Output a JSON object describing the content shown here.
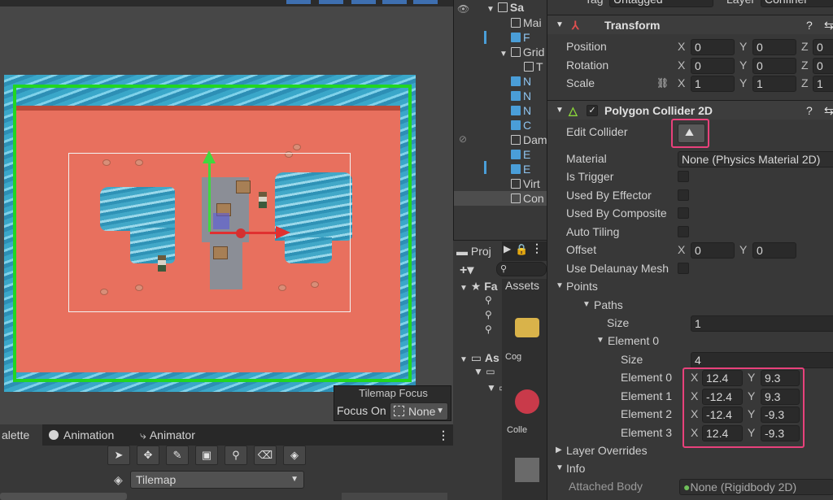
{
  "hierarchy": {
    "items": [
      {
        "label": "Sa",
        "indent": 0
      },
      {
        "label": "Mai",
        "indent": 1
      },
      {
        "label": "F",
        "indent": 1
      },
      {
        "label": "Grid",
        "indent": 1
      },
      {
        "label": "T",
        "indent": 2
      },
      {
        "label": "N",
        "indent": 1
      },
      {
        "label": "N",
        "indent": 1
      },
      {
        "label": "N",
        "indent": 1
      },
      {
        "label": "C",
        "indent": 1
      },
      {
        "label": "Dam",
        "indent": 1
      },
      {
        "label": "E",
        "indent": 1
      },
      {
        "label": "E",
        "indent": 1
      },
      {
        "label": "Virt",
        "indent": 1
      },
      {
        "label": "Con",
        "indent": 1
      }
    ]
  },
  "project": {
    "tab_label": "Proj",
    "favorites_label": "Fa",
    "assets_label": "As",
    "assets_header": "Assets",
    "asset_items": [
      "Cog",
      "Colle"
    ]
  },
  "inspector": {
    "tag_label": "Tag",
    "tag_value": "Untagged",
    "layer_label": "Layer",
    "layer_value": "Confiner",
    "transform": {
      "title": "Transform",
      "position": {
        "label": "Position",
        "x": "0",
        "y": "0",
        "z": "0"
      },
      "rotation": {
        "label": "Rotation",
        "x": "0",
        "y": "0",
        "z": "0"
      },
      "scale": {
        "label": "Scale",
        "x": "1",
        "y": "1",
        "z": "1"
      }
    },
    "collider": {
      "title": "Polygon Collider 2D",
      "edit_collider": "Edit Collider",
      "material_label": "Material",
      "material_value": "None (Physics Material 2D)",
      "is_trigger": "Is Trigger",
      "used_by_effector": "Used By Effector",
      "used_by_composite": "Used By Composite",
      "auto_tiling": "Auto Tiling",
      "offset_label": "Offset",
      "offset_x": "0",
      "offset_y": "0",
      "delaunay": "Use Delaunay Mesh",
      "points_label": "Points",
      "paths_label": "Paths",
      "size_label": "Size",
      "paths_size": "1",
      "element0_label": "Element 0",
      "element0_size": "4",
      "elements": [
        {
          "label": "Element 0",
          "x": "12.4",
          "y": "9.3"
        },
        {
          "label": "Element 1",
          "x": "-12.4",
          "y": "9.3"
        },
        {
          "label": "Element 2",
          "x": "-12.4",
          "y": "-9.3"
        },
        {
          "label": "Element 3",
          "x": "12.4",
          "y": "-9.3"
        }
      ],
      "layer_overrides": "Layer Overrides",
      "info": "Info",
      "attached_body_label": "Attached Body",
      "attached_body_value": "None (Rigidbody 2D)"
    }
  },
  "scene": {
    "tilemap_focus_title": "Tilemap Focus",
    "focus_on_label": "Focus On",
    "focus_on_value": "None"
  },
  "bottom": {
    "tabs": [
      "alette",
      "Animation",
      "Animator"
    ],
    "tilemap_value": "Tilemap"
  },
  "colors": {
    "highlight": "#e8417b",
    "selection_green": "#22d622",
    "accent_blue": "#4a9ed8"
  }
}
